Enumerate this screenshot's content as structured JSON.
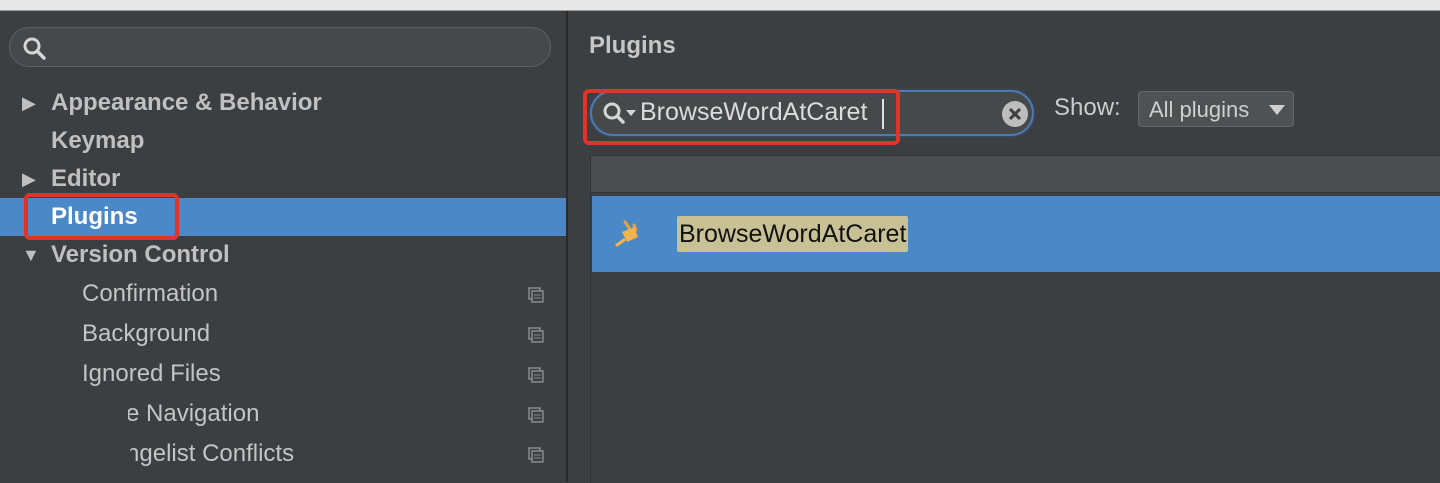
{
  "sidebar": {
    "search": {
      "placeholder": ""
    },
    "items": [
      {
        "label": "Appearance & Behavior",
        "expander": "▶"
      },
      {
        "label": "Keymap"
      },
      {
        "label": "Editor",
        "expander": "▶"
      },
      {
        "label": "Plugins"
      },
      {
        "label": "Version Control",
        "expander": "▼"
      },
      {
        "label": "Confirmation"
      },
      {
        "label": "Background"
      },
      {
        "label": "Ignored Files"
      },
      {
        "label": "Issue Navigation"
      },
      {
        "label": "Changelist Conflicts"
      }
    ]
  },
  "main": {
    "title": "Plugins",
    "search": {
      "value": "BrowseWordAtCaret"
    },
    "show": {
      "label": "Show:",
      "selected": "All plugins"
    },
    "results": [
      {
        "name": "BrowseWordAtCaret"
      }
    ]
  },
  "colors": {
    "selection": "#4a88c7",
    "annotation": "#e0342b",
    "highlight": "#c8c195"
  }
}
